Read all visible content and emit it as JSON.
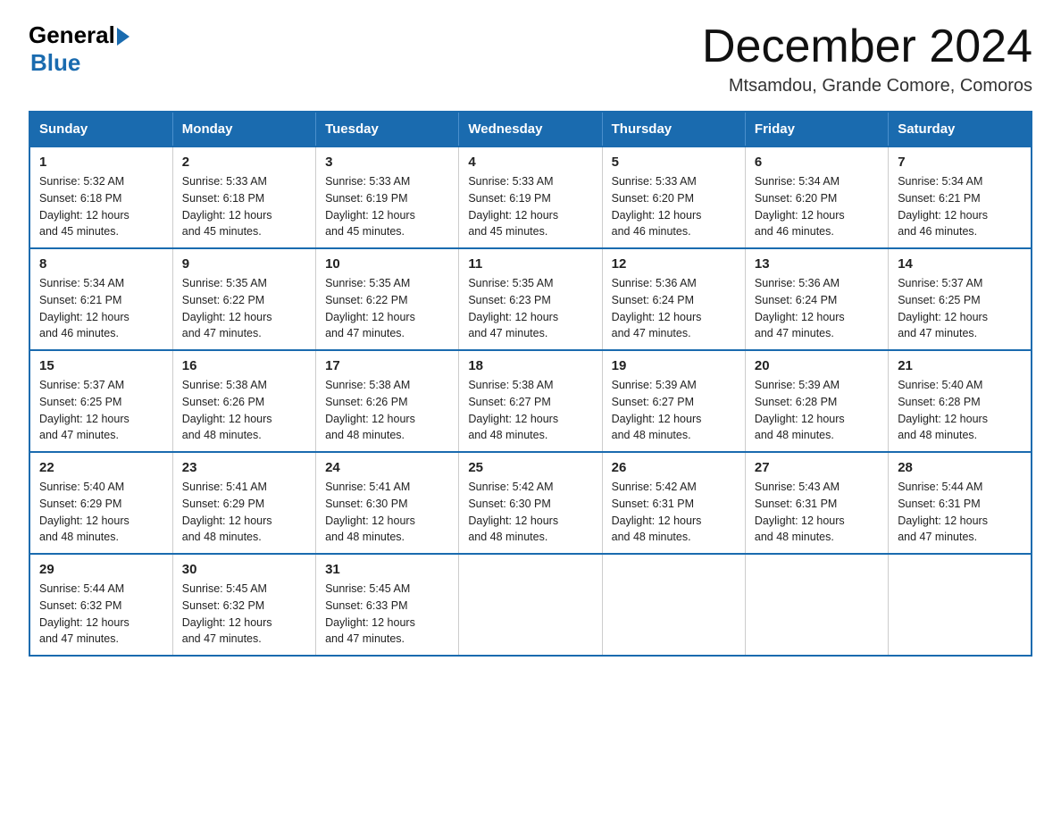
{
  "header": {
    "logo_general": "General",
    "logo_blue": "Blue",
    "title": "December 2024",
    "subtitle": "Mtsamdou, Grande Comore, Comoros"
  },
  "days_of_week": [
    "Sunday",
    "Monday",
    "Tuesday",
    "Wednesday",
    "Thursday",
    "Friday",
    "Saturday"
  ],
  "weeks": [
    [
      {
        "day": "1",
        "sunrise": "5:32 AM",
        "sunset": "6:18 PM",
        "daylight": "12 hours and 45 minutes."
      },
      {
        "day": "2",
        "sunrise": "5:33 AM",
        "sunset": "6:18 PM",
        "daylight": "12 hours and 45 minutes."
      },
      {
        "day": "3",
        "sunrise": "5:33 AM",
        "sunset": "6:19 PM",
        "daylight": "12 hours and 45 minutes."
      },
      {
        "day": "4",
        "sunrise": "5:33 AM",
        "sunset": "6:19 PM",
        "daylight": "12 hours and 45 minutes."
      },
      {
        "day": "5",
        "sunrise": "5:33 AM",
        "sunset": "6:20 PM",
        "daylight": "12 hours and 46 minutes."
      },
      {
        "day": "6",
        "sunrise": "5:34 AM",
        "sunset": "6:20 PM",
        "daylight": "12 hours and 46 minutes."
      },
      {
        "day": "7",
        "sunrise": "5:34 AM",
        "sunset": "6:21 PM",
        "daylight": "12 hours and 46 minutes."
      }
    ],
    [
      {
        "day": "8",
        "sunrise": "5:34 AM",
        "sunset": "6:21 PM",
        "daylight": "12 hours and 46 minutes."
      },
      {
        "day": "9",
        "sunrise": "5:35 AM",
        "sunset": "6:22 PM",
        "daylight": "12 hours and 47 minutes."
      },
      {
        "day": "10",
        "sunrise": "5:35 AM",
        "sunset": "6:22 PM",
        "daylight": "12 hours and 47 minutes."
      },
      {
        "day": "11",
        "sunrise": "5:35 AM",
        "sunset": "6:23 PM",
        "daylight": "12 hours and 47 minutes."
      },
      {
        "day": "12",
        "sunrise": "5:36 AM",
        "sunset": "6:24 PM",
        "daylight": "12 hours and 47 minutes."
      },
      {
        "day": "13",
        "sunrise": "5:36 AM",
        "sunset": "6:24 PM",
        "daylight": "12 hours and 47 minutes."
      },
      {
        "day": "14",
        "sunrise": "5:37 AM",
        "sunset": "6:25 PM",
        "daylight": "12 hours and 47 minutes."
      }
    ],
    [
      {
        "day": "15",
        "sunrise": "5:37 AM",
        "sunset": "6:25 PM",
        "daylight": "12 hours and 47 minutes."
      },
      {
        "day": "16",
        "sunrise": "5:38 AM",
        "sunset": "6:26 PM",
        "daylight": "12 hours and 48 minutes."
      },
      {
        "day": "17",
        "sunrise": "5:38 AM",
        "sunset": "6:26 PM",
        "daylight": "12 hours and 48 minutes."
      },
      {
        "day": "18",
        "sunrise": "5:38 AM",
        "sunset": "6:27 PM",
        "daylight": "12 hours and 48 minutes."
      },
      {
        "day": "19",
        "sunrise": "5:39 AM",
        "sunset": "6:27 PM",
        "daylight": "12 hours and 48 minutes."
      },
      {
        "day": "20",
        "sunrise": "5:39 AM",
        "sunset": "6:28 PM",
        "daylight": "12 hours and 48 minutes."
      },
      {
        "day": "21",
        "sunrise": "5:40 AM",
        "sunset": "6:28 PM",
        "daylight": "12 hours and 48 minutes."
      }
    ],
    [
      {
        "day": "22",
        "sunrise": "5:40 AM",
        "sunset": "6:29 PM",
        "daylight": "12 hours and 48 minutes."
      },
      {
        "day": "23",
        "sunrise": "5:41 AM",
        "sunset": "6:29 PM",
        "daylight": "12 hours and 48 minutes."
      },
      {
        "day": "24",
        "sunrise": "5:41 AM",
        "sunset": "6:30 PM",
        "daylight": "12 hours and 48 minutes."
      },
      {
        "day": "25",
        "sunrise": "5:42 AM",
        "sunset": "6:30 PM",
        "daylight": "12 hours and 48 minutes."
      },
      {
        "day": "26",
        "sunrise": "5:42 AM",
        "sunset": "6:31 PM",
        "daylight": "12 hours and 48 minutes."
      },
      {
        "day": "27",
        "sunrise": "5:43 AM",
        "sunset": "6:31 PM",
        "daylight": "12 hours and 48 minutes."
      },
      {
        "day": "28",
        "sunrise": "5:44 AM",
        "sunset": "6:31 PM",
        "daylight": "12 hours and 47 minutes."
      }
    ],
    [
      {
        "day": "29",
        "sunrise": "5:44 AM",
        "sunset": "6:32 PM",
        "daylight": "12 hours and 47 minutes."
      },
      {
        "day": "30",
        "sunrise": "5:45 AM",
        "sunset": "6:32 PM",
        "daylight": "12 hours and 47 minutes."
      },
      {
        "day": "31",
        "sunrise": "5:45 AM",
        "sunset": "6:33 PM",
        "daylight": "12 hours and 47 minutes."
      },
      null,
      null,
      null,
      null
    ]
  ],
  "labels": {
    "sunrise": "Sunrise:",
    "sunset": "Sunset:",
    "daylight": "Daylight:"
  }
}
